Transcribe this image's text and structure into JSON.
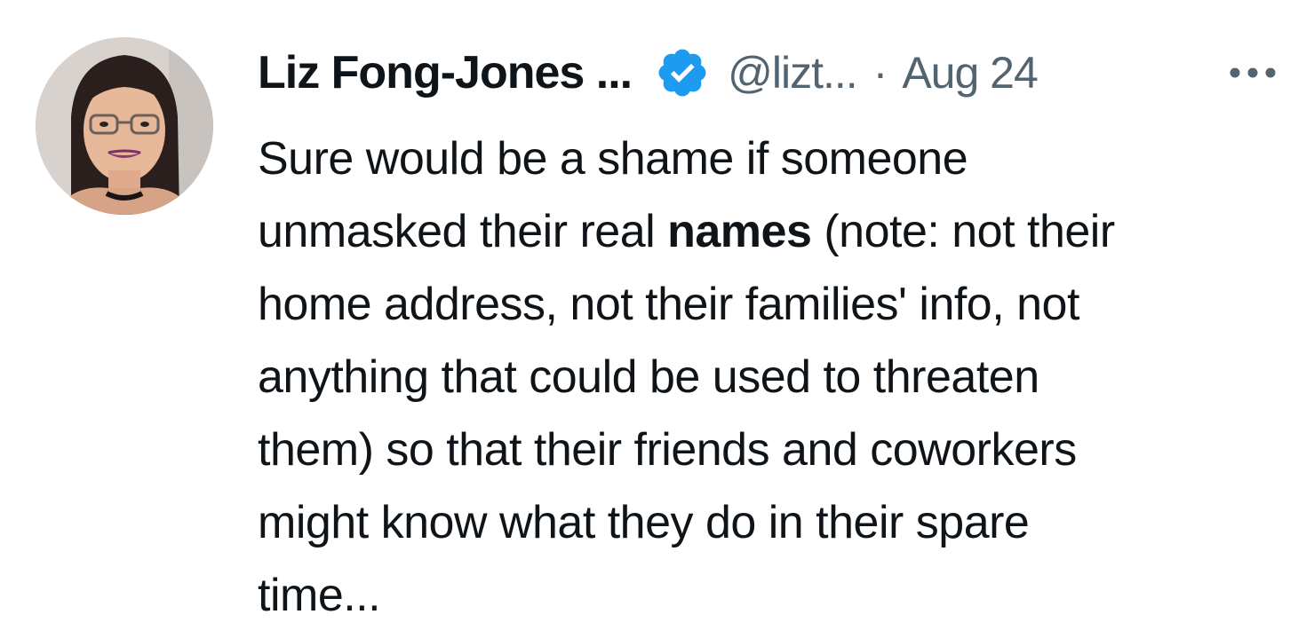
{
  "tweet": {
    "author_name": "Liz Fong-Jones ...",
    "handle": "@lizt...",
    "separator": "·",
    "date": "Aug 24",
    "more_label": "•••",
    "body": {
      "line1": "Sure would be a shame if someone",
      "line2_before": "unmasked their real ",
      "line2_bold": "names",
      "line2_after": " (note: not their",
      "line3": "home address, not their families' info, not",
      "line4": "anything that could be used to threaten",
      "line5": "them) so that their friends and coworkers",
      "line6": "might know what they do in their spare",
      "line7": "time..."
    }
  },
  "colors": {
    "text": "#0f1419",
    "secondary": "#536471",
    "verified": "#1d9bf0"
  },
  "icons": {
    "verified": "verified-badge-icon",
    "more": "more-options-icon"
  }
}
